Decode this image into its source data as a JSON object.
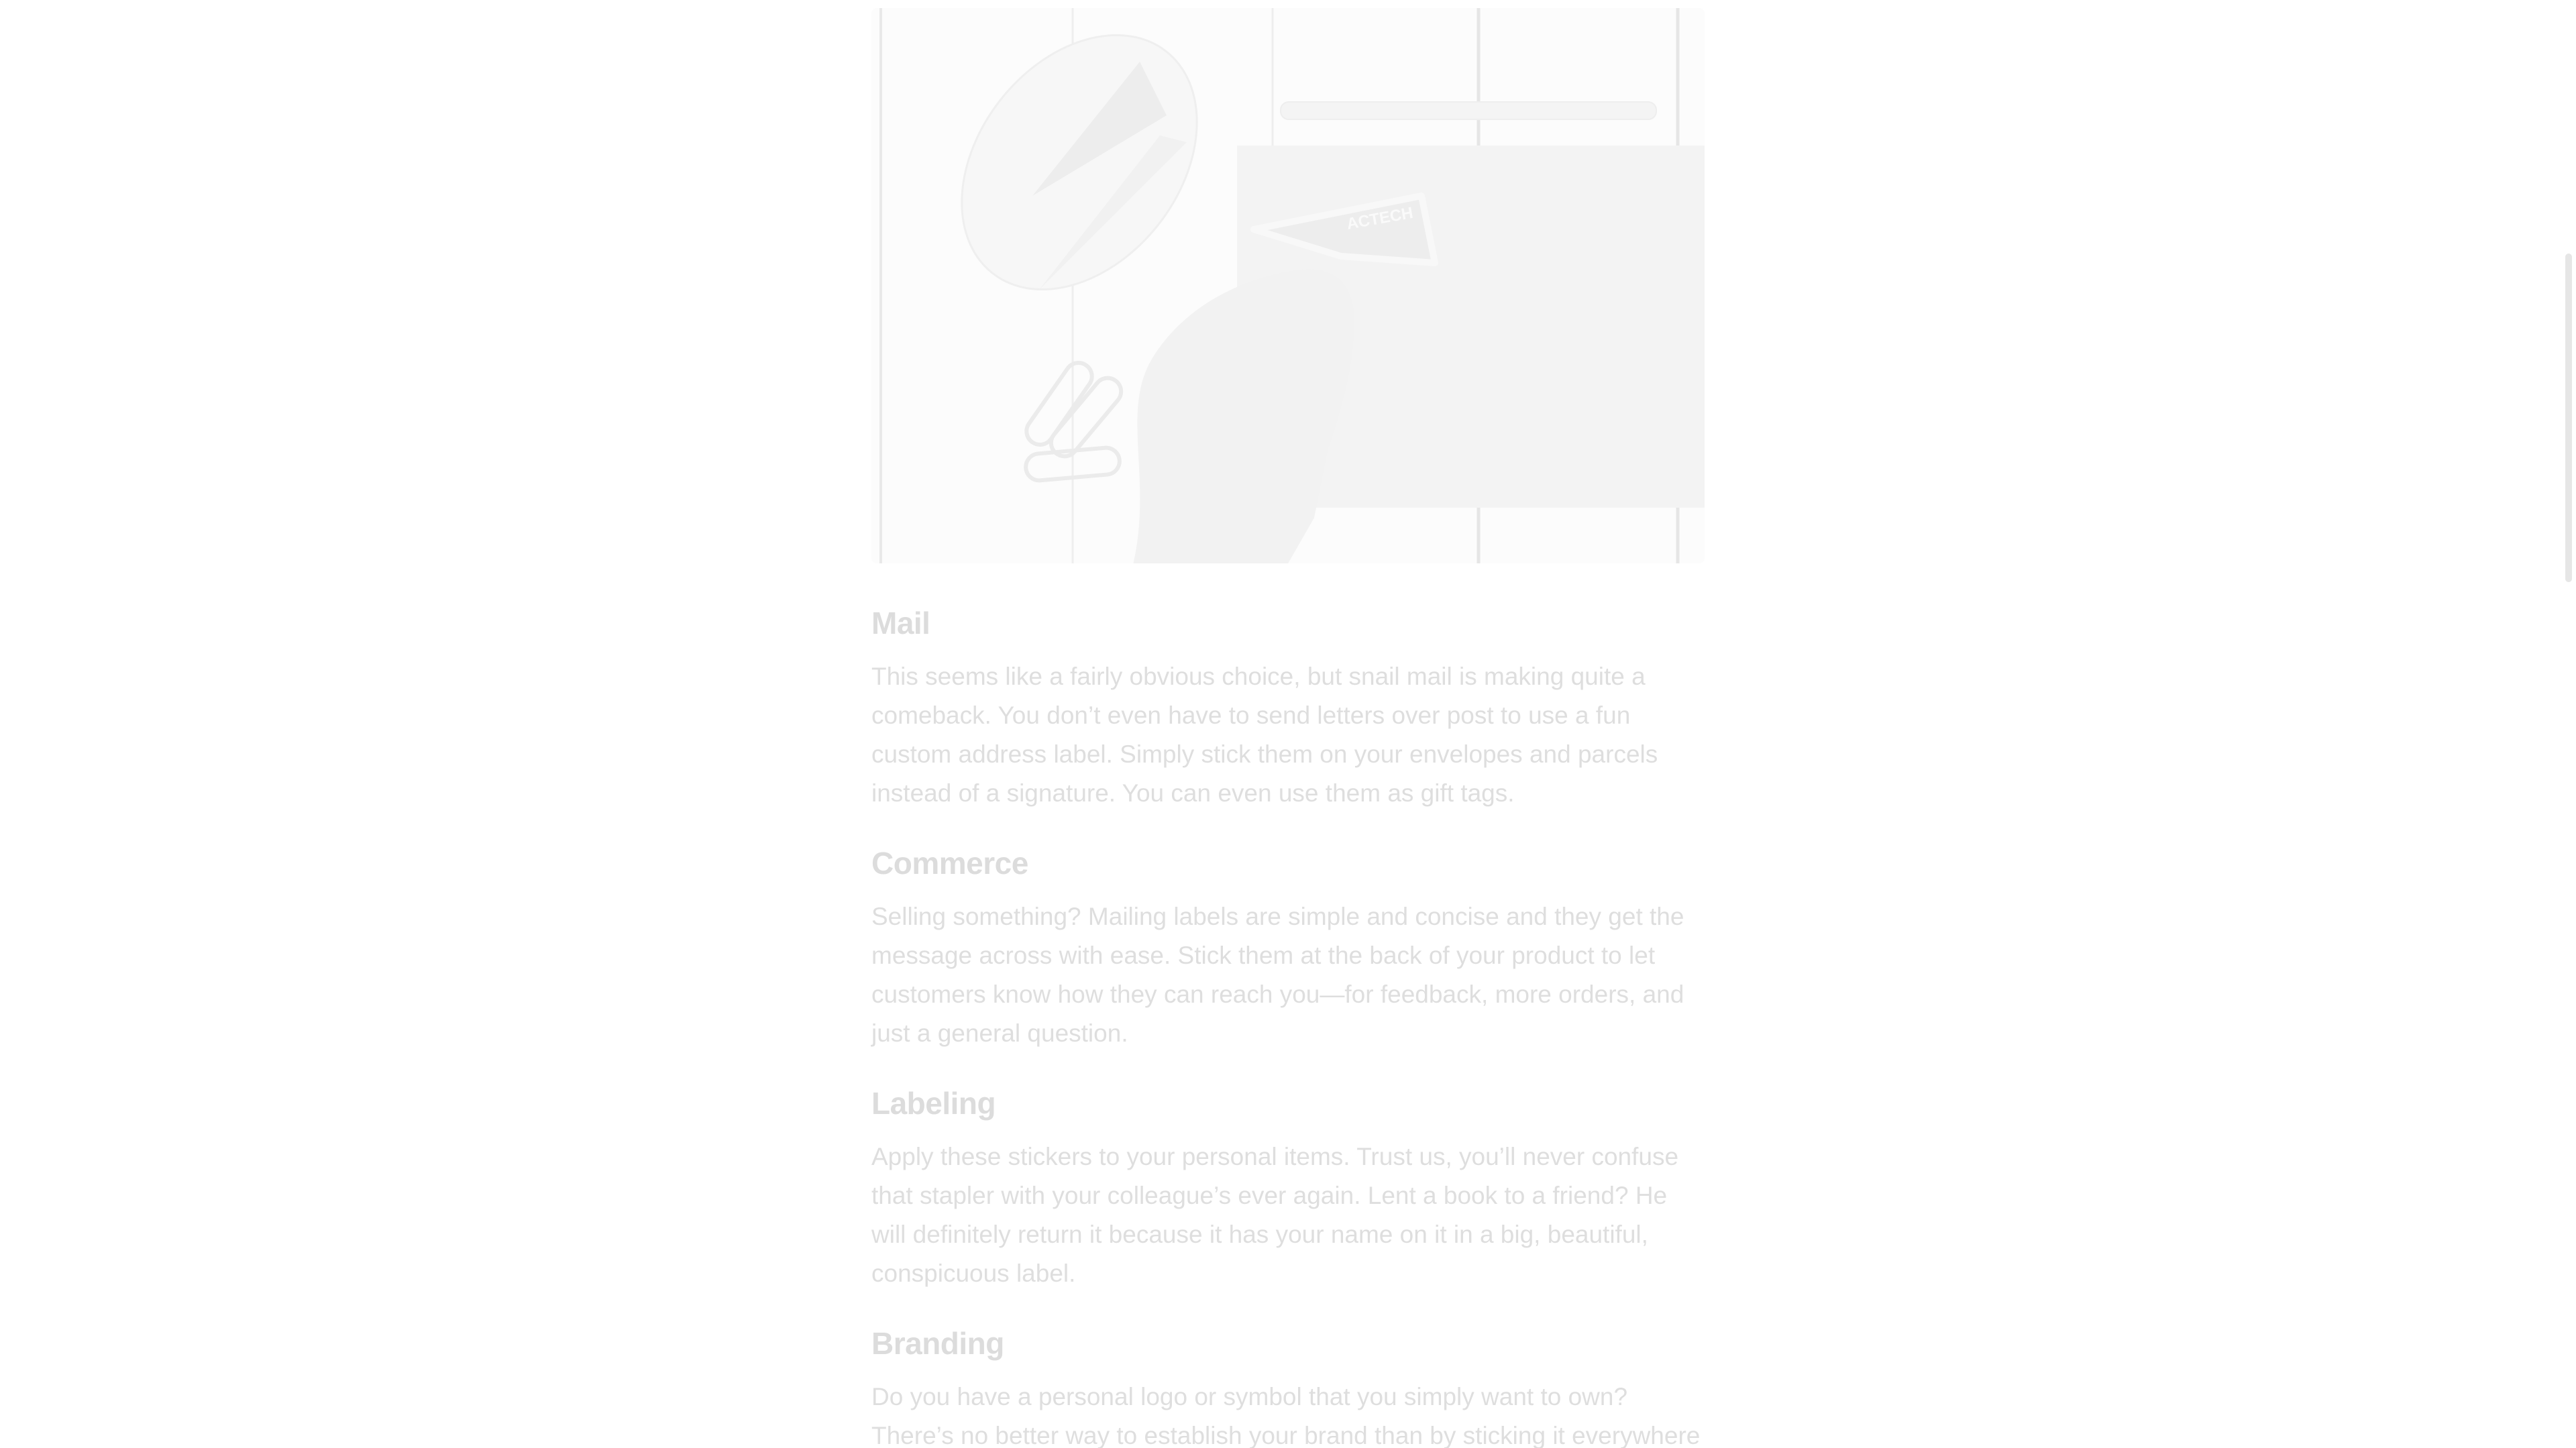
{
  "article": {
    "hero_image": {
      "alt": "",
      "sticker_text": "ACTECH"
    },
    "sections": [
      {
        "heading": "Mail",
        "body": "This seems like a fairly obvious choice, but snail mail is making quite a comeback. You don’t even have to send letters over post to use a fun custom address label. Simply stick them on your envelopes and parcels instead of a signature. You can even use them as gift tags."
      },
      {
        "heading": "Commerce",
        "body": "Selling something? Mailing labels are simple and concise and they get the message across with ease. Stick them at the back of your product to let customers know how they can reach you—for feedback, more orders, and just a general question."
      },
      {
        "heading": "Labeling",
        "body": "Apply these stickers to your personal items. Trust us, you’ll never confuse that stapler with your colleague’s ever again. Lent a book to a friend? He will definitely return it because it has your name on it in a big, beautiful, conspicuous label."
      },
      {
        "heading": "Branding",
        "body": "Do you have a personal logo or symbol that you simply want to own? There’s no better way to establish your brand than by sticking it everywhere"
      }
    ]
  },
  "colors": {
    "heading": "#dcdcdc",
    "body_text": "#dedede",
    "background": "#ffffff"
  }
}
